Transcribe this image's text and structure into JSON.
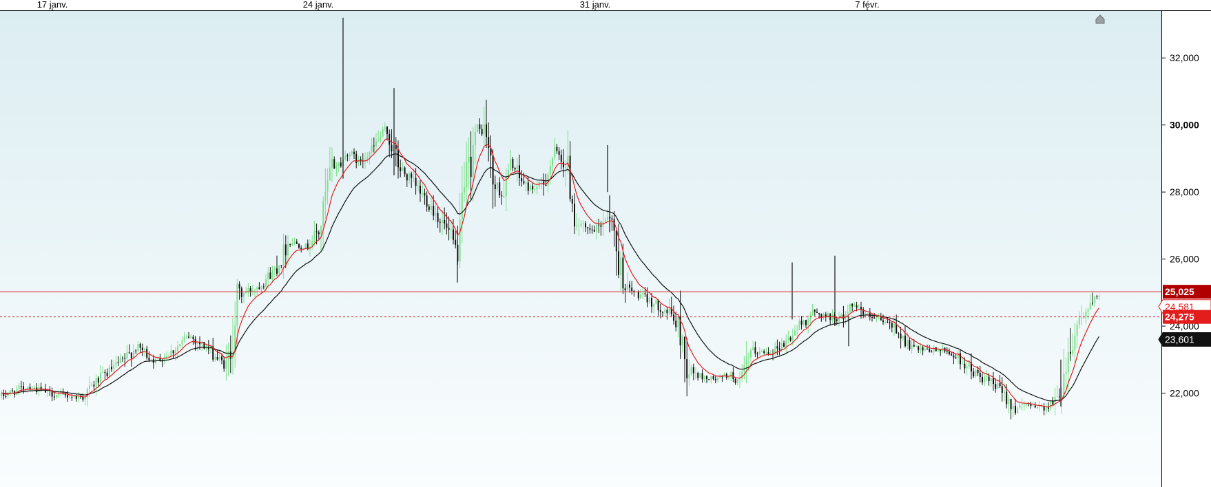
{
  "chart_data": {
    "type": "candlestick",
    "x_ticks": [
      "17 janv.",
      "24 janv.",
      "31 janv.",
      "7 févr."
    ],
    "y_ticks": [
      {
        "value": 22000,
        "label": "22,000"
      },
      {
        "value": 24000,
        "label": "24,000"
      },
      {
        "value": 26000,
        "label": "26,000"
      },
      {
        "value": 28000,
        "label": "28,000"
      },
      {
        "value": 30000,
        "label": "30,000"
      },
      {
        "value": 32000,
        "label": "32,000"
      }
    ],
    "ylim": [
      19200,
      33400
    ],
    "grid": false,
    "price_lines": [
      {
        "value": 25025,
        "label": "25,025",
        "style": "solid",
        "color": "#d32f2f",
        "label_bg": "#b00000",
        "label_fg": "#ffffff"
      },
      {
        "value": 24275,
        "label": "24,275",
        "style": "dashed",
        "color": "#d32f2f",
        "label_bg": "#e31c1c",
        "label_fg": "#ffffff"
      }
    ],
    "markers": [
      {
        "value": 24581,
        "label": "24,581",
        "label_bg": "#ffffff",
        "label_fg": "#e31c1c",
        "border": "#e31c1c"
      },
      {
        "value": 23601,
        "label": "23,601",
        "label_bg": "#111111",
        "label_fg": "#ffffff",
        "border": "#111111"
      }
    ],
    "series": [
      {
        "name": "",
        "kind": "candles",
        "up_color": "#7ee08a",
        "down_color": "#111111"
      },
      {
        "name": "",
        "kind": "ma_fast",
        "color": "#e31c1c"
      },
      {
        "name": "",
        "kind": "ma_slow",
        "color": "#111111"
      }
    ],
    "price_path": [
      [
        0,
        21900
      ],
      [
        40,
        22200
      ],
      [
        80,
        21950
      ],
      [
        120,
        21880
      ],
      [
        140,
        22350
      ],
      [
        180,
        23000
      ],
      [
        200,
        23400
      ],
      [
        225,
        22950
      ],
      [
        250,
        23250
      ],
      [
        275,
        23700
      ],
      [
        300,
        23350
      ],
      [
        330,
        22750
      ],
      [
        345,
        24900
      ],
      [
        375,
        25200
      ],
      [
        400,
        25700
      ],
      [
        420,
        26550
      ],
      [
        445,
        26350
      ],
      [
        465,
        26900
      ],
      [
        482,
        28800
      ],
      [
        495,
        28850
      ],
      [
        505,
        29200
      ],
      [
        520,
        28900
      ],
      [
        540,
        29250
      ],
      [
        560,
        29900
      ],
      [
        580,
        28700
      ],
      [
        600,
        28250
      ],
      [
        620,
        27750
      ],
      [
        645,
        27000
      ],
      [
        665,
        26200
      ],
      [
        675,
        28000
      ],
      [
        690,
        29750
      ],
      [
        705,
        29900
      ],
      [
        715,
        28300
      ],
      [
        730,
        27850
      ],
      [
        742,
        28900
      ],
      [
        752,
        28500
      ],
      [
        762,
        28200
      ],
      [
        772,
        28100
      ],
      [
        782,
        28150
      ],
      [
        790,
        28300
      ],
      [
        805,
        29200
      ],
      [
        815,
        29050
      ],
      [
        825,
        28600
      ],
      [
        835,
        27200
      ],
      [
        850,
        26850
      ],
      [
        865,
        26850
      ],
      [
        885,
        27400
      ],
      [
        897,
        26000
      ],
      [
        910,
        25100
      ],
      [
        930,
        24900
      ],
      [
        955,
        24600
      ],
      [
        975,
        24350
      ],
      [
        990,
        23700
      ],
      [
        995,
        22800
      ],
      [
        1015,
        22500
      ],
      [
        1040,
        22400
      ],
      [
        1060,
        22550
      ],
      [
        1075,
        22300
      ],
      [
        1090,
        23200
      ],
      [
        1120,
        23250
      ],
      [
        1140,
        23500
      ],
      [
        1160,
        24000
      ],
      [
        1180,
        24400
      ],
      [
        1200,
        24300
      ],
      [
        1220,
        24200
      ],
      [
        1240,
        24700
      ],
      [
        1260,
        24250
      ],
      [
        1280,
        24150
      ],
      [
        1300,
        23950
      ],
      [
        1320,
        23400
      ],
      [
        1340,
        23250
      ],
      [
        1360,
        23300
      ],
      [
        1380,
        23200
      ],
      [
        1400,
        22900
      ],
      [
        1420,
        22500
      ],
      [
        1440,
        22300
      ],
      [
        1460,
        21900
      ],
      [
        1475,
        21500
      ],
      [
        1495,
        21700
      ],
      [
        1515,
        21550
      ],
      [
        1535,
        21800
      ],
      [
        1550,
        23100
      ],
      [
        1565,
        24200
      ],
      [
        1580,
        24500
      ],
      [
        1595,
        24900
      ],
      [
        1600,
        24580
      ]
    ],
    "spikes": [
      {
        "x": 498,
        "high": 33200,
        "low": 28400
      },
      {
        "x": 572,
        "high": 31100,
        "low": 28500
      },
      {
        "x": 664,
        "high": 26000,
        "low": 25300
      },
      {
        "x": 882,
        "high": 29400,
        "low": 28000
      },
      {
        "x": 885,
        "high": 27900,
        "low": 26800
      },
      {
        "x": 1150,
        "high": 25900,
        "low": 24200
      },
      {
        "x": 1212,
        "high": 26100,
        "low": 24000
      },
      {
        "x": 1232,
        "high": 24300,
        "low": 23400
      },
      {
        "x": 1540,
        "high": 23000,
        "low": 21600
      }
    ]
  }
}
